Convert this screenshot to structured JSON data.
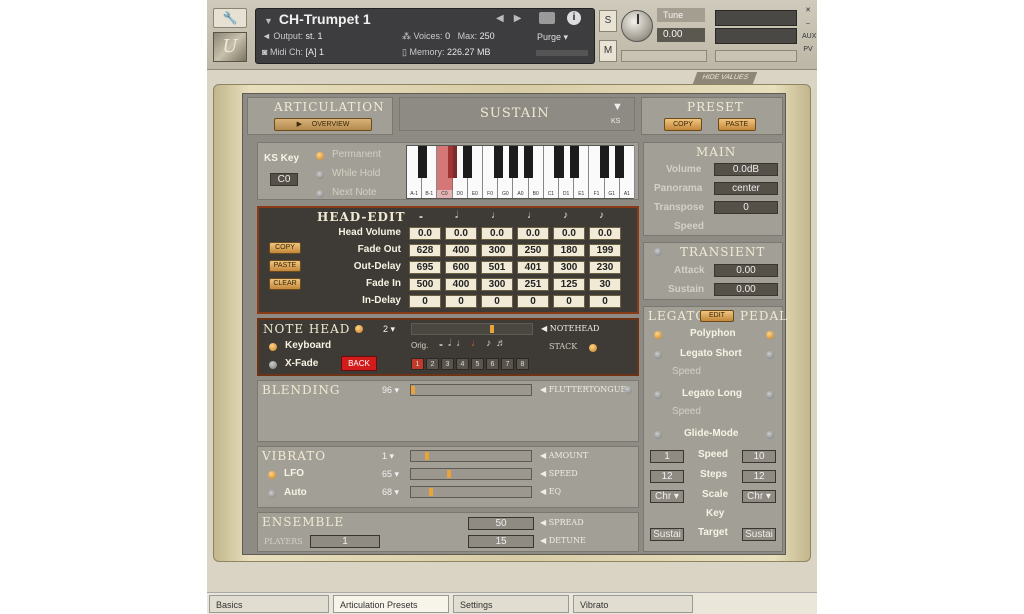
{
  "header": {
    "instrument_name": "CH-Trumpet 1",
    "output_label": "Output:",
    "output_value": "st. 1",
    "voices_label": "Voices:",
    "voices_value": "0",
    "max_label": "Max:",
    "max_value": "250",
    "purge_label": "Purge",
    "midi_label": "Midi Ch:",
    "midi_value": "[A] 1",
    "memory_label": "Memory:",
    "memory_value": "226.27 MB",
    "solo_label": "S",
    "mute_label": "M",
    "tune_label": "Tune",
    "tune_value": "0.00",
    "aux_label": "AUX",
    "pv_label": "PV",
    "hide_values": "HIDE VALUES"
  },
  "articulation": {
    "title": "ARTICULATION",
    "overview_btn": "OVERVIEW",
    "current": "SUSTAIN",
    "ks_label": "KS"
  },
  "preset": {
    "title": "PRESET",
    "copy": "COPY",
    "paste": "PASTE"
  },
  "ks": {
    "key_label": "KS Key",
    "key_value": "C0",
    "options": [
      "Permanent",
      "While Hold",
      "Next Note"
    ],
    "keys": [
      "A-1",
      "B-1",
      "C0",
      "D0",
      "E0",
      "F0",
      "G0",
      "A0",
      "B0",
      "C1",
      "D1",
      "E1",
      "F1",
      "G1",
      "A1"
    ]
  },
  "main": {
    "title": "MAIN",
    "volume_label": "Volume",
    "volume_value": "0.0dB",
    "panorama_label": "Panorama",
    "panorama_value": "center",
    "transpose_label": "Transpose",
    "transpose_value": "0",
    "speed_label": "Speed"
  },
  "transient": {
    "title": "TRANSIENT",
    "attack_label": "Attack",
    "attack_value": "0.00",
    "sustain_label": "Sustain",
    "sustain_value": "0.00"
  },
  "head_edit": {
    "title": "HEAD-EDIT",
    "copy": "COPY",
    "paste": "PASTE",
    "clear": "CLEAR",
    "note_glyphs": [
      "𝅝",
      "𝅗𝅥",
      "♩",
      "♩",
      "♪",
      "♪"
    ],
    "rows": [
      {
        "label": "Head Volume",
        "values": [
          "0.0",
          "0.0",
          "0.0",
          "0.0",
          "0.0",
          "0.0"
        ]
      },
      {
        "label": "Fade Out",
        "values": [
          "628",
          "400",
          "300",
          "250",
          "180",
          "199"
        ]
      },
      {
        "label": "Out-Delay",
        "values": [
          "695",
          "600",
          "501",
          "401",
          "300",
          "230"
        ]
      },
      {
        "label": "Fade In",
        "values": [
          "500",
          "400",
          "300",
          "251",
          "125",
          "30"
        ]
      },
      {
        "label": "In-Delay",
        "values": [
          "0",
          "0",
          "0",
          "0",
          "0",
          "0"
        ]
      }
    ]
  },
  "note_head": {
    "title": "NOTE HEAD",
    "count": "2",
    "notehead_label": "NOTEHEAD",
    "keyboard_label": "Keyboard",
    "xfade_label": "X-Fade",
    "back_btn": "BACK",
    "orig_label": "Orig.",
    "stack_label": "STACK",
    "pages": [
      "1",
      "2",
      "3",
      "4",
      "5",
      "6",
      "7",
      "8"
    ]
  },
  "blending": {
    "title": "BLENDING",
    "value": "96",
    "target": "FLUTTERTONGUE"
  },
  "vibrato": {
    "title": "VIBRATO",
    "lfo_label": "LFO",
    "auto_label": "Auto",
    "amount_value": "1",
    "speed_value": "65",
    "eq_value": "68",
    "amount_label": "AMOUNT",
    "speed_label": "SPEED",
    "eq_label": "EQ"
  },
  "ensemble": {
    "title": "ENSEMBLE",
    "players_label": "PLAYERS",
    "players_value": "1",
    "spread_value": "50",
    "spread_label": "SPREAD",
    "detune_value": "15",
    "detune_label": "DETUNE"
  },
  "legato": {
    "title": "LEGATO",
    "edit_btn": "EDIT",
    "pedal_label": "PEDAL",
    "polyphon": "Polyphon",
    "legato_short": "Legato Short",
    "speed1": "Speed",
    "legato_long": "Legato Long",
    "speed2": "Speed",
    "glide_mode": "Glide-Mode",
    "glide_speed_left": "1",
    "glide_speed_label": "Speed",
    "glide_speed_right": "10",
    "steps_left": "12",
    "steps_label": "Steps",
    "steps_right": "12",
    "scale_left": "Chr",
    "scale_label": "Scale",
    "scale_right": "Chr",
    "key_label": "Key",
    "target_left": "Sustai",
    "target_label": "Target",
    "target_right": "Sustai"
  },
  "tabs": [
    "Basics",
    "Articulation Presets",
    "Settings",
    "Vibrato"
  ]
}
